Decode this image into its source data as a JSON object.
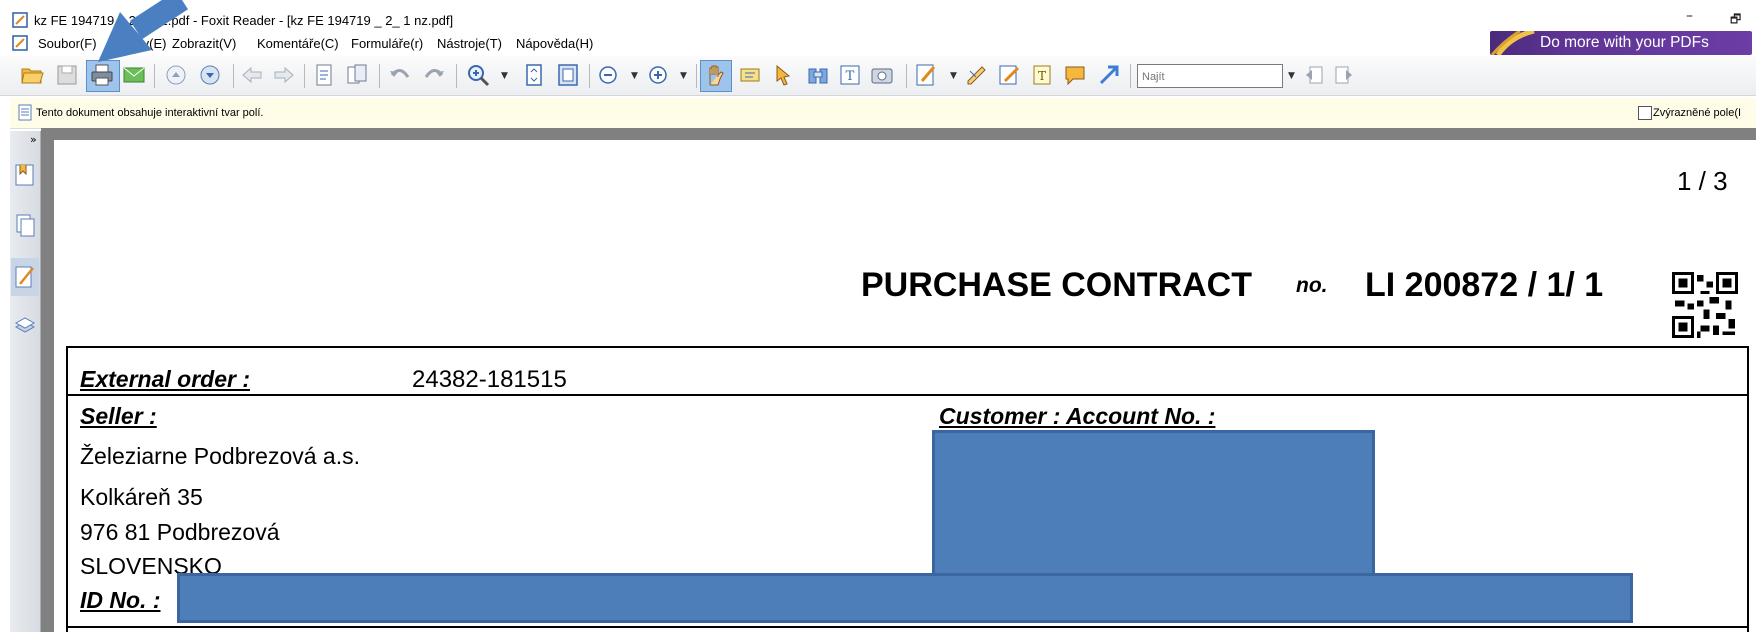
{
  "window": {
    "title": "kz FE 194719 _ 2_1 nz.pdf - Foxit Reader - [kz FE 194719 _ 2_ 1 nz.pdf]",
    "minimize_label": "–",
    "restore_label": "🗗"
  },
  "menu": {
    "items": [
      "Soubor(F)",
      "Úpravy(E)",
      "Zobrazit(V)",
      "Komentáře(C)",
      "Formuláře(r)",
      "Nástroje(T)",
      "Nápověda(H)"
    ]
  },
  "promo": {
    "label": "Do more with your PDFs"
  },
  "toolbar": {
    "find_placeholder": "Najít",
    "icons": [
      "open-icon",
      "save-icon",
      "print-icon",
      "email-icon",
      "prev-page-icon",
      "next-page-icon",
      "back-icon",
      "forward-icon",
      "extract-icon",
      "insert-icon",
      "undo-icon",
      "redo-icon",
      "zoom-in-icon",
      "fit-page-icon",
      "fit-width-icon",
      "zoom-out-icon",
      "zoom-plus-icon",
      "hand-tool-icon",
      "select-text-icon",
      "select-icon",
      "snapshot-icon",
      "typewriter-icon",
      "camera-icon",
      "edit-icon",
      "stamp-icon",
      "note-icon",
      "textbox-icon",
      "comment-icon",
      "arrow-tool-icon",
      "find-prev-icon",
      "find-next-icon"
    ]
  },
  "infobar": {
    "message": "Tento dokument obsahuje interaktivní tvar polí.",
    "highlight_label": "Zvýrazněné pole(I"
  },
  "document": {
    "page_number": "1 / 3",
    "heading": "PURCHASE CONTRACT",
    "heading_no": "no.",
    "contract_number": "LI 200872 / 1/ 1",
    "external_order_label": "External order :",
    "external_order_value": "24382-181515",
    "seller_label": "Seller :",
    "seller_lines": [
      "Železiarne Podbrezová a.s.",
      "Kolkáreň 35",
      "976 81 Podbrezová",
      "SLOVENSKO"
    ],
    "customer_label": "Customer :   Account No. :",
    "id_label": "ID No. :"
  },
  "colors": {
    "redaction": "#4d7eb9",
    "annotation_arrow": "#4a7fc1",
    "promo_bg": "#5f3595",
    "infobar_bg": "#fffce7"
  }
}
